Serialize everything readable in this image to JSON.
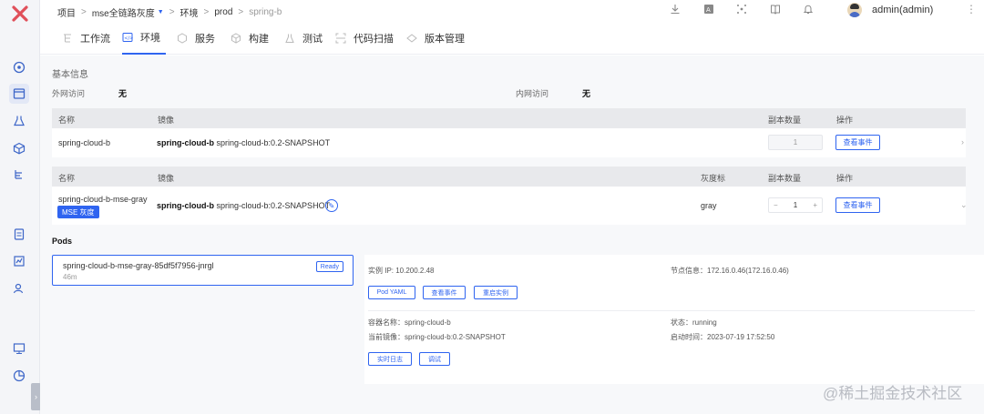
{
  "breadcrumb": [
    "项目",
    "mse全链路灰度",
    "环境",
    "prod",
    "spring-b"
  ],
  "user": {
    "name": "admin(admin)"
  },
  "tabs": [
    {
      "label": "工作流",
      "icon": "workflow-icon"
    },
    {
      "label": "环境",
      "icon": "environment-icon",
      "active": true
    },
    {
      "label": "服务",
      "icon": "service-icon"
    },
    {
      "label": "构建",
      "icon": "build-icon"
    },
    {
      "label": "测试",
      "icon": "test-icon"
    },
    {
      "label": "代码扫描",
      "icon": "code-scan-icon"
    },
    {
      "label": "版本管理",
      "icon": "version-icon"
    }
  ],
  "basic": {
    "title": "基本信息",
    "external_label": "外网访问",
    "external_value": "无",
    "internal_label": "内网访问",
    "internal_value": "无"
  },
  "table1": {
    "headers": {
      "name": "名称",
      "image": "镜像",
      "replicas": "副本数量",
      "ops": "操作"
    },
    "row": {
      "name": "spring-cloud-b",
      "image_name": "spring-cloud-b",
      "image_tag": "spring-cloud-b:0.2-SNAPSHOT",
      "replicas": "1",
      "action": "查看事件"
    }
  },
  "table2": {
    "headers": {
      "name": "名称",
      "image": "镜像",
      "gray": "灰度标",
      "replicas": "副本数量",
      "ops": "操作"
    },
    "row": {
      "name": "spring-cloud-b-mse-gray",
      "badge": "MSE 灰度",
      "image_name": "spring-cloud-b",
      "image_tag": "spring-cloud-b:0.2-SNAPSHOT",
      "gray": "gray",
      "replicas": "1",
      "minus": "−",
      "plus": "+",
      "action": "查看事件"
    }
  },
  "pods": {
    "title": "Pods",
    "card": {
      "name": "spring-cloud-b-mse-gray-85df5f7956-jnrgl",
      "age": "46m",
      "status": "Ready"
    },
    "detail": {
      "ip": "实例 IP: 10.200.2.48",
      "node": "节点信息：172.16.0.46(172.16.0.46)",
      "buttons": [
        "Pod YAML",
        "查看事件",
        "重启实例"
      ],
      "container": "容器名称：spring-cloud-b",
      "state": "状态：running",
      "image": "当前镜像：spring-cloud-b:0.2-SNAPSHOT",
      "start": "启动时间：2023-07-19 17:52:50",
      "buttons2": [
        "实时日志",
        "调试"
      ]
    }
  },
  "watermark": "@稀土掘金技术社区",
  "colors": {
    "accent": "#2f64f0",
    "logo": "#e0505a"
  }
}
